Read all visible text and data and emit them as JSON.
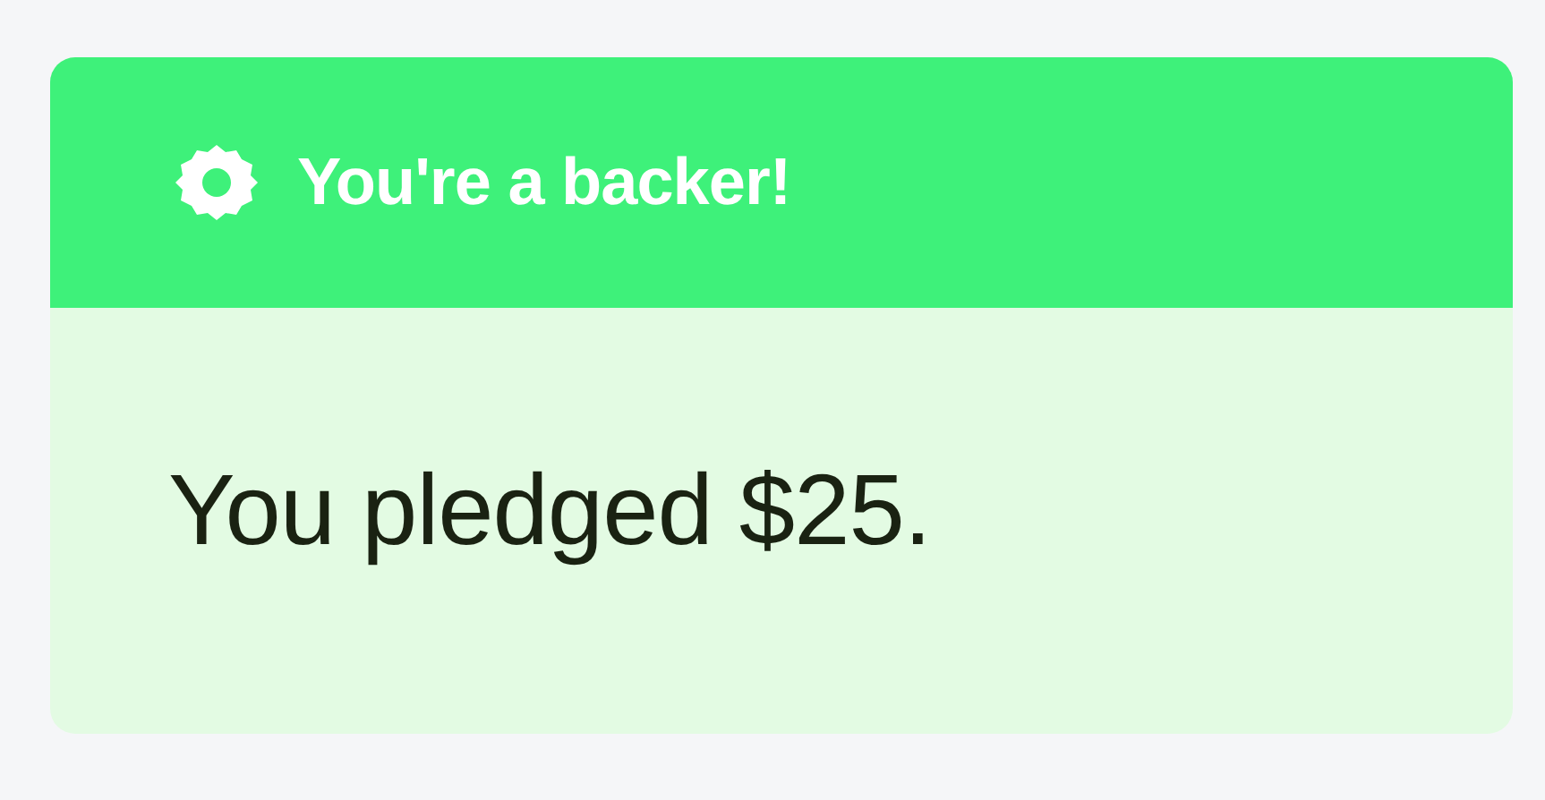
{
  "banner": {
    "title": "You're a backer!"
  },
  "pledge_text": "You pledged $25."
}
